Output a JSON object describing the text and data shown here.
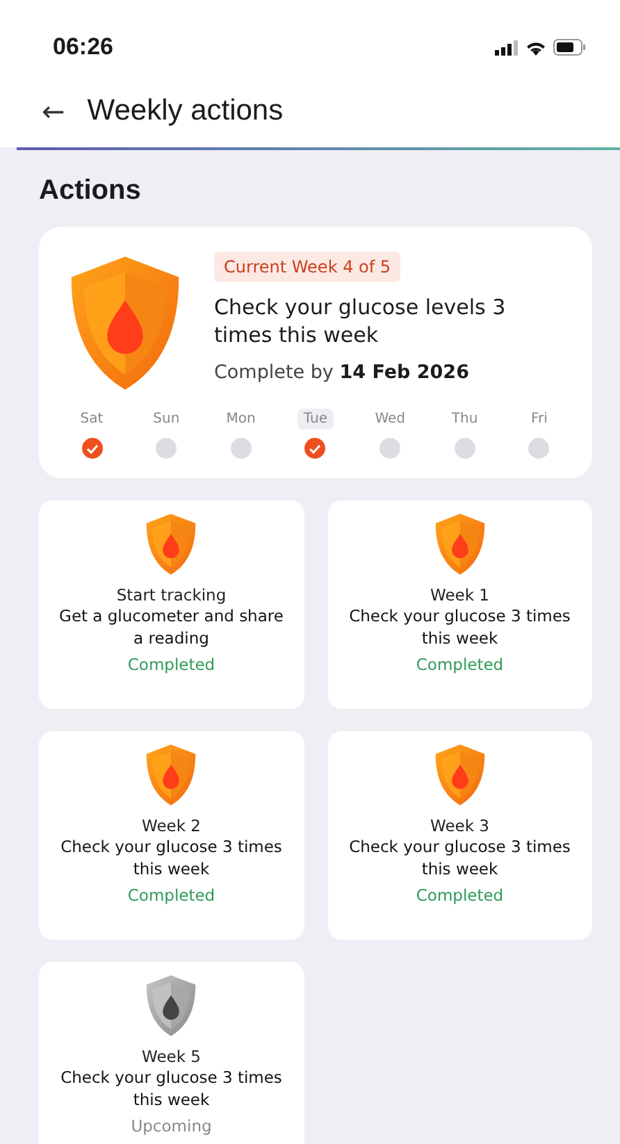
{
  "status_bar": {
    "time": "06:26"
  },
  "header": {
    "back": "←",
    "title": "Weekly actions"
  },
  "section_title": "Actions",
  "current": {
    "badge": "Current Week 4 of 5",
    "title": "Check your glucose levels 3 times this week",
    "due": "Complete by **14 Feb 2026**",
    "days": [
      {
        "label": "Sat",
        "selected": false,
        "checked": true
      },
      {
        "label": "Sun",
        "selected": false,
        "checked": false
      },
      {
        "label": "Mon",
        "selected": false,
        "checked": false
      },
      {
        "label": "Tue",
        "selected": true,
        "checked": true
      },
      {
        "label": "Wed",
        "selected": false,
        "checked": false
      },
      {
        "label": "Thu",
        "selected": false,
        "checked": false
      },
      {
        "label": "Fri",
        "selected": false,
        "checked": false
      }
    ]
  },
  "weeks": [
    {
      "kind": "completed",
      "heading": "Start tracking",
      "task": "Get a glucometer and share a reading",
      "status": "Completed"
    },
    {
      "kind": "completed",
      "heading": "Week 1",
      "task": "Check your glucose 3 times this week",
      "status": "Completed"
    },
    {
      "kind": "completed",
      "heading": "Week 2",
      "task": "Check your glucose 3 times this week",
      "status": "Completed"
    },
    {
      "kind": "completed",
      "heading": "Week 3",
      "task": "Check your glucose 3 times this week",
      "status": "Completed"
    },
    {
      "kind": "upcoming",
      "heading": "Week 5",
      "task": "Check your glucose 3 times this week",
      "status": "Upcoming"
    }
  ]
}
